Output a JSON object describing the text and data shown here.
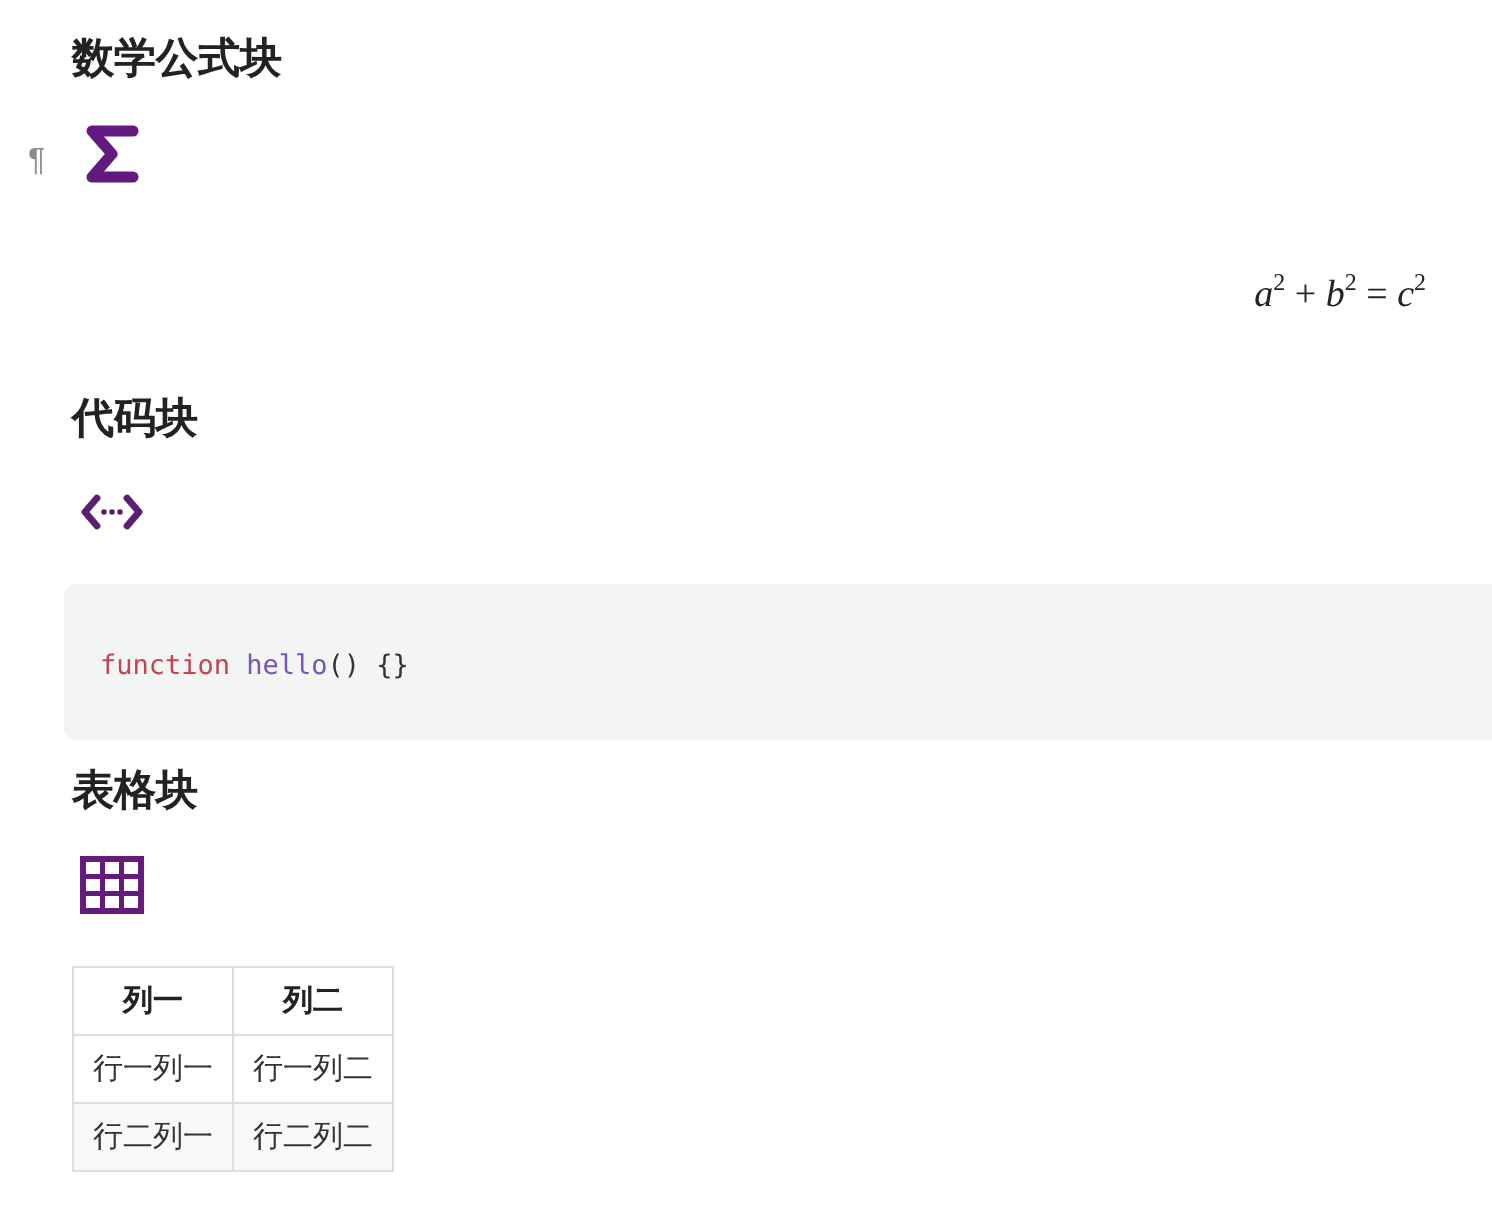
{
  "sections": [
    {
      "kind": "math",
      "heading": "数学公式块",
      "block_mark": "¶",
      "formula": "*a*$^{2}$ + *b*$^{2}$ = *c*$^{2}$"
    },
    {
      "kind": "code",
      "heading": "代码块",
      "code_tokens": [
        {
          "kind": "keyword",
          "text": "function "
        },
        {
          "kind": "function",
          "text": "hello"
        },
        {
          "kind": "plain",
          "text": "() {}"
        }
      ]
    },
    {
      "kind": "table",
      "heading": "表格块",
      "table": {
        "columns": [
          "列一",
          "列二"
        ],
        "rows": [
          [
            "行一列一",
            "行一列二"
          ],
          [
            "行二列一",
            "行二列二"
          ]
        ]
      }
    }
  ]
}
